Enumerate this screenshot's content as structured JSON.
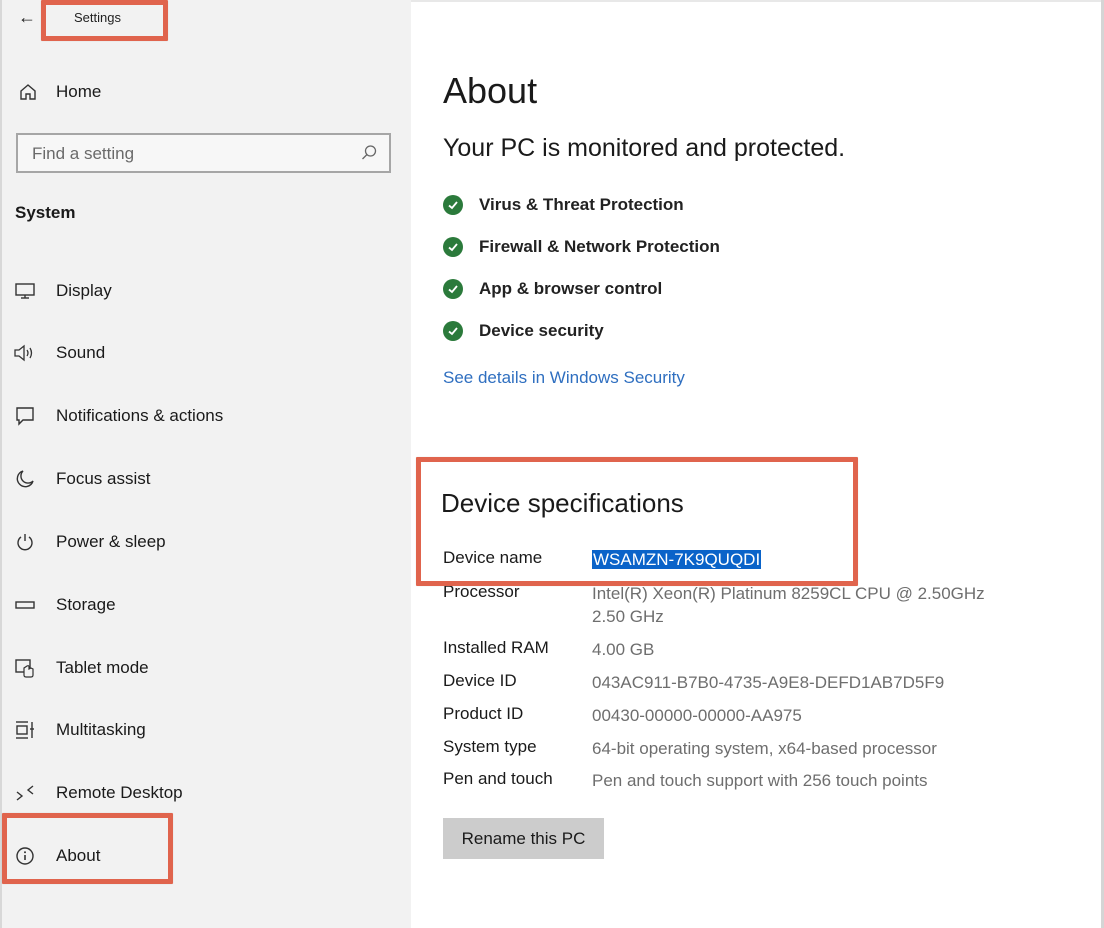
{
  "window": {
    "title": "Settings"
  },
  "sidebar": {
    "home_label": "Home",
    "search_placeholder": "Find a setting",
    "section_title": "System",
    "items": [
      {
        "label": "Display",
        "icon": "display-icon"
      },
      {
        "label": "Sound",
        "icon": "sound-icon"
      },
      {
        "label": "Notifications & actions",
        "icon": "notifications-icon"
      },
      {
        "label": "Focus assist",
        "icon": "focus-assist-icon"
      },
      {
        "label": "Power & sleep",
        "icon": "power-icon"
      },
      {
        "label": "Storage",
        "icon": "storage-icon"
      },
      {
        "label": "Tablet mode",
        "icon": "tablet-mode-icon"
      },
      {
        "label": "Multitasking",
        "icon": "multitasking-icon"
      },
      {
        "label": "Remote Desktop",
        "icon": "remote-desktop-icon"
      },
      {
        "label": "About",
        "icon": "info-icon"
      }
    ]
  },
  "main": {
    "title": "About",
    "protection_heading": "Your PC is monitored and protected.",
    "protection_items": [
      "Virus & Threat Protection",
      "Firewall & Network Protection",
      "App & browser control",
      "Device security"
    ],
    "security_link": "See details in Windows Security",
    "specs_heading": "Device specifications",
    "specs": {
      "device_name": {
        "label": "Device name",
        "value": "WSAMZN-7K9QUQDI"
      },
      "processor": {
        "label": "Processor",
        "value": "Intel(R) Xeon(R) Platinum 8259CL CPU @ 2.50GHz",
        "value2": "2.50 GHz"
      },
      "ram": {
        "label": "Installed RAM",
        "value": "4.00 GB"
      },
      "device_id": {
        "label": "Device ID",
        "value": "043AC911-B7B0-4735-A9E8-DEFD1AB7D5F9"
      },
      "product_id": {
        "label": "Product ID",
        "value": "00430-00000-00000-AA975"
      },
      "system_type": {
        "label": "System type",
        "value": "64-bit operating system, x64-based processor"
      },
      "pen_touch": {
        "label": "Pen and touch",
        "value": "Pen and touch support with 256 touch points"
      }
    },
    "rename_button": "Rename this PC"
  },
  "colors": {
    "highlight_box": "#e0644d",
    "check_green": "#2b7a3b",
    "link_blue": "#2f6fc0",
    "selection_blue": "#0a63c9"
  }
}
